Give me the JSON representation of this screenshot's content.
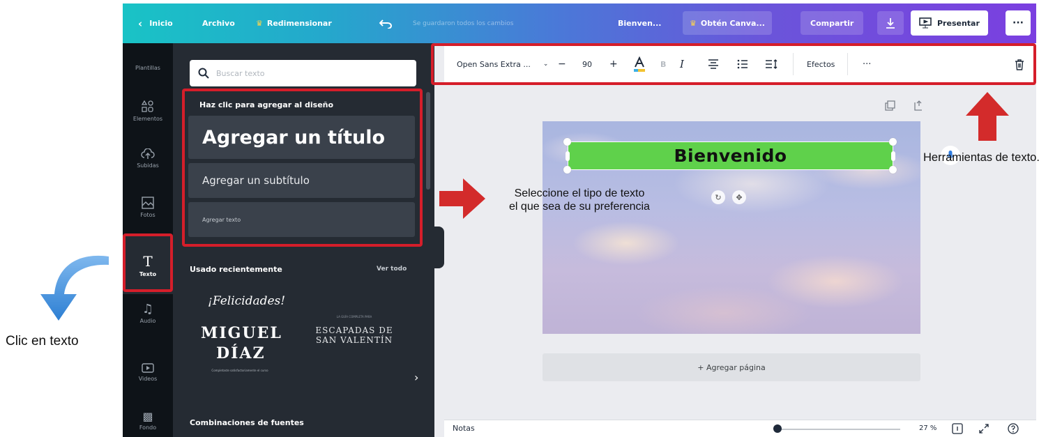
{
  "annotations": {
    "left": "Clic en texto",
    "right": "Herramientas de texto.",
    "center_line1": "Seleccione el tipo de texto",
    "center_line2": "el que sea de su preferencia"
  },
  "topbar": {
    "back": "Inicio",
    "file": "Archivo",
    "resize": "Redimensionar",
    "saved_status": "Se guardaron todos los cambios",
    "doc_title": "Bienven...",
    "upgrade": "Obtén Canva...",
    "share": "Compartir",
    "present": "Presentar",
    "more": "···"
  },
  "rail": {
    "items": [
      {
        "label": "Plantillas"
      },
      {
        "label": "Elementos"
      },
      {
        "label": "Subidas"
      },
      {
        "label": "Fotos"
      },
      {
        "label": "Texto"
      },
      {
        "label": "Audio"
      },
      {
        "label": "Videos"
      },
      {
        "label": "Fondo"
      }
    ]
  },
  "panel": {
    "search_placeholder": "Buscar texto",
    "click_to_add": "Haz clic para agregar al diseño",
    "add_title": "Agregar un título",
    "add_subtitle": "Agregar un subtítulo",
    "add_body": "Agregar texto",
    "recent": "Usado recientemente",
    "see_all": "Ver todo",
    "combos": "Combinaciones de fuentes",
    "thumb1": {
      "script": "¡Felicidades!",
      "line1": "MIGUEL",
      "line2": "DÍAZ",
      "tiny": "Completaste satisfactoriamente el curso"
    },
    "thumb2": {
      "tiny": "LA GUÍA COMPLETA PARA",
      "line1": "ESCAPADAS DE",
      "line2": "SAN VALENTÍN"
    }
  },
  "toolbar": {
    "font": "Open Sans Extra ...",
    "font_size": "90",
    "minus": "−",
    "plus": "+",
    "effects": "Efectos",
    "more": "···"
  },
  "canvas": {
    "title": "Bienvenido",
    "add_page": "+ Agregar página"
  },
  "bottombar": {
    "notes": "Notas",
    "zoom": "27 %"
  },
  "colors": {
    "highlight": "#d51e2a",
    "arrow": "#d32b2b",
    "blue_arrow": "#3a8ed8",
    "title_box": "#5fd14b"
  }
}
